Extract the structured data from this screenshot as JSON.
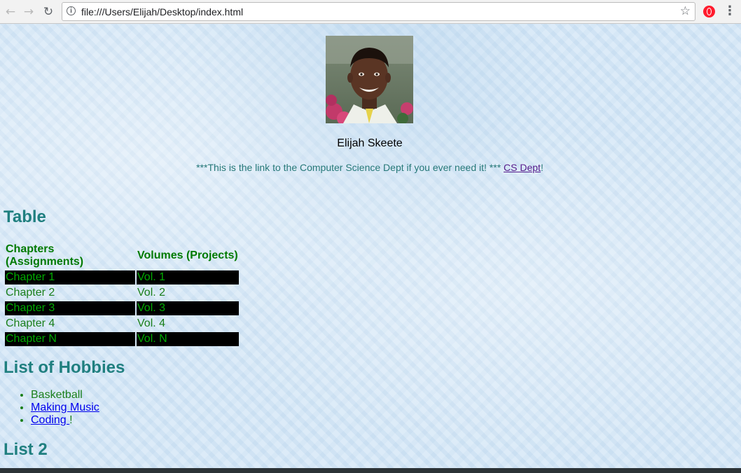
{
  "browser": {
    "url": "file:///Users/Elijah/Desktop/index.html",
    "icons": [
      "back-arrow-icon",
      "forward-arrow-icon",
      "reload-icon",
      "info-icon",
      "star-icon",
      "opera-icon",
      "menu-icon"
    ]
  },
  "profile": {
    "name": "Elijah Skeete",
    "notice_prefix": "***This is the link to the Computer Science Dept if you ever need it! *** ",
    "link_label": "CS Dept",
    "notice_suffix": "!"
  },
  "table_section": {
    "heading": "Table",
    "headers": [
      "Chapters (Assignments)",
      "Volumes (Projects)"
    ],
    "rows": [
      [
        "Chapter 1",
        "Vol. 1"
      ],
      [
        "Chapter 2",
        "Vol. 2"
      ],
      [
        "Chapter 3",
        "Vol. 3"
      ],
      [
        "Chapter 4",
        "Vol. 4"
      ],
      [
        "Chapter N",
        "Vol. N"
      ]
    ]
  },
  "hobbies": {
    "heading": "List of Hobbies",
    "items": {
      "basketball": "Basketball",
      "music": "Making Music",
      "coding": "Coding ",
      "coding_suffix": "!"
    }
  },
  "list2": {
    "heading": "List 2"
  },
  "colors": {
    "heading": "#1f7f7f",
    "table_text": "#009a00",
    "row_highlight": "#000000",
    "link": "#0000ee",
    "visited_link": "#551a8b"
  }
}
